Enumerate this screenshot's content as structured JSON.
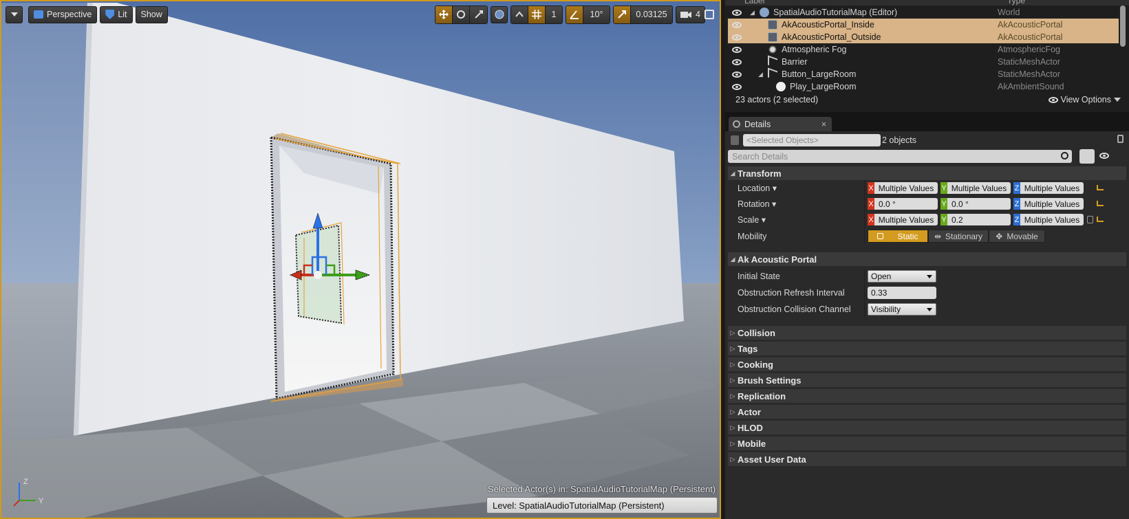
{
  "viewport": {
    "toolbar": {
      "menu_label": "",
      "perspective_label": "Perspective",
      "lit_label": "Lit",
      "show_label": "Show",
      "rotation_snap": "10°",
      "scale_snap": "0.03125",
      "camera_speed": "4",
      "grid_snap": "1"
    },
    "selected_actors_text": "Selected Actor(s) in:  SpatialAudioTutorialMap (Persistent)",
    "level_text": "Level:  SpatialAudioTutorialMap (Persistent)",
    "axis_labels": {
      "z": "Z",
      "y": "Y"
    },
    "accent": "#d19a1c"
  },
  "outliner": {
    "columns": {
      "label": "Label",
      "type": "Type"
    },
    "rows": [
      {
        "label": "SpatialAudioTutorialMap (Editor)",
        "type": "World",
        "indent": 0,
        "icon": "world-icon",
        "selected": false
      },
      {
        "label": "AkAcousticPortal_Inside",
        "type": "AkAcousticPortal",
        "indent": 1,
        "icon": "actor-icon",
        "selected": true
      },
      {
        "label": "AkAcousticPortal_Outside",
        "type": "AkAcousticPortal",
        "indent": 1,
        "icon": "actor-icon",
        "selected": true
      },
      {
        "label": "Atmospheric Fog",
        "type": "AtmosphericFog",
        "indent": 1,
        "icon": "fog-icon",
        "selected": false
      },
      {
        "label": "Barrier",
        "type": "StaticMeshActor",
        "indent": 1,
        "icon": "mesh-icon",
        "selected": false
      },
      {
        "label": "Button_LargeRoom",
        "type": "StaticMeshActor",
        "indent": 1,
        "icon": "mesh-icon",
        "selected": false
      },
      {
        "label": "Play_LargeRoom",
        "type": "AkAmbientSound",
        "indent": 2,
        "icon": "sound-icon",
        "selected": false
      }
    ],
    "footer_count": "23 actors (2 selected)",
    "view_options": "View Options"
  },
  "details": {
    "tab_label": "Details",
    "selected_objects_placeholder": "<Selected Objects>",
    "object_count": "2 objects",
    "search_placeholder": "Search Details",
    "transform": {
      "title": "Transform",
      "location_label": "Location",
      "rotation_label": "Rotation",
      "scale_label": "Scale",
      "mobility_label": "Mobility",
      "location": {
        "x": "Multiple Values",
        "y": "Multiple Values",
        "z": "Multiple Values"
      },
      "rotation": {
        "x": "0.0 °",
        "y": "0.0 °",
        "z": "Multiple Values"
      },
      "scale": {
        "x": "Multiple Values",
        "y": "0.2",
        "z": "Multiple Values"
      },
      "mobility_options": [
        "Static",
        "Stationary",
        "Movable"
      ],
      "mobility_selected": "Static"
    },
    "portal": {
      "title": "Ak Acoustic Portal",
      "initial_state_label": "Initial State",
      "initial_state_value": "Open",
      "refresh_label": "Obstruction Refresh Interval",
      "refresh_value": "0.33",
      "channel_label": "Obstruction Collision Channel",
      "channel_value": "Visibility"
    },
    "collapsed_categories": [
      "Collision",
      "Tags",
      "Cooking",
      "Brush Settings",
      "Replication",
      "Actor",
      "HLOD",
      "Mobile",
      "Asset User Data"
    ]
  }
}
